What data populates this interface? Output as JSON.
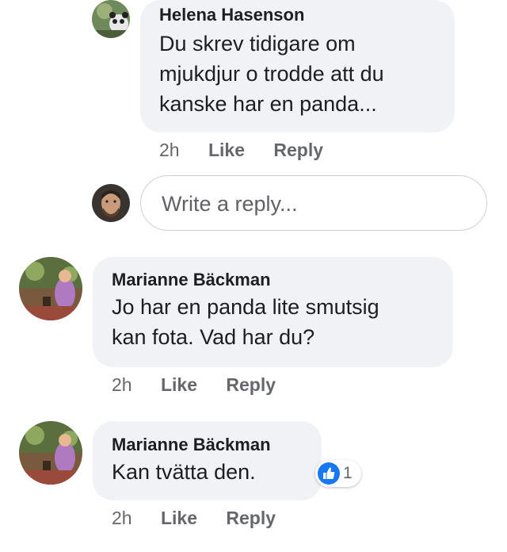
{
  "comments": [
    {
      "author": "Helena Hasenson",
      "text_lines": [
        "Du skrev tidigare om",
        "mjukdjur o trodde att du",
        "kanske har en panda..."
      ],
      "time": "2h",
      "like_label": "Like",
      "reply_label": "Reply"
    },
    {
      "author": "Marianne Bäckman",
      "text_lines": [
        "Jo har en panda lite smutsig",
        "kan fota. Vad har du?"
      ],
      "time": "2h",
      "like_label": "Like",
      "reply_label": "Reply"
    },
    {
      "author": "Marianne Bäckman",
      "text_lines": [
        "Kan tvätta den."
      ],
      "time": "2h",
      "like_label": "Like",
      "reply_label": "Reply",
      "reaction_count": "1"
    }
  ],
  "reply_box": {
    "placeholder": "Write a reply..."
  },
  "colors": {
    "bubble": "#f1f2f6",
    "like_blue": "#1877f2",
    "meta": "#65676b"
  },
  "icons": {
    "reaction": "thumbs-up-icon"
  }
}
